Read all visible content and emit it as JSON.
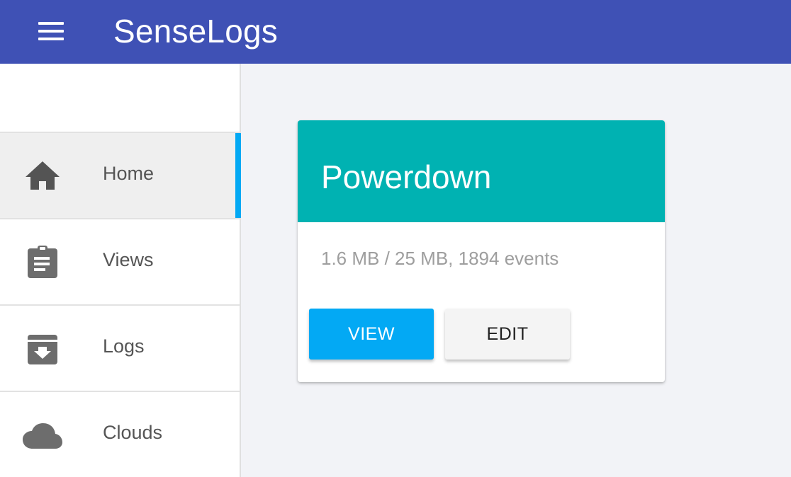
{
  "app": {
    "title": "SenseLogs"
  },
  "colors": {
    "header": "#3f51b5",
    "accent": "#03a9f4",
    "card_header": "#00b2b2"
  },
  "sidebar": {
    "items": [
      {
        "label": "Home",
        "icon": "home-icon",
        "active": true
      },
      {
        "label": "Views",
        "icon": "clipboard-icon",
        "active": false
      },
      {
        "label": "Logs",
        "icon": "archive-download-icon",
        "active": false
      },
      {
        "label": "Clouds",
        "icon": "cloud-icon",
        "active": false
      }
    ]
  },
  "card": {
    "title": "Powerdown",
    "subtitle": "1.6 MB / 25 MB, 1894 events",
    "view_label": "VIEW",
    "edit_label": "EDIT"
  }
}
